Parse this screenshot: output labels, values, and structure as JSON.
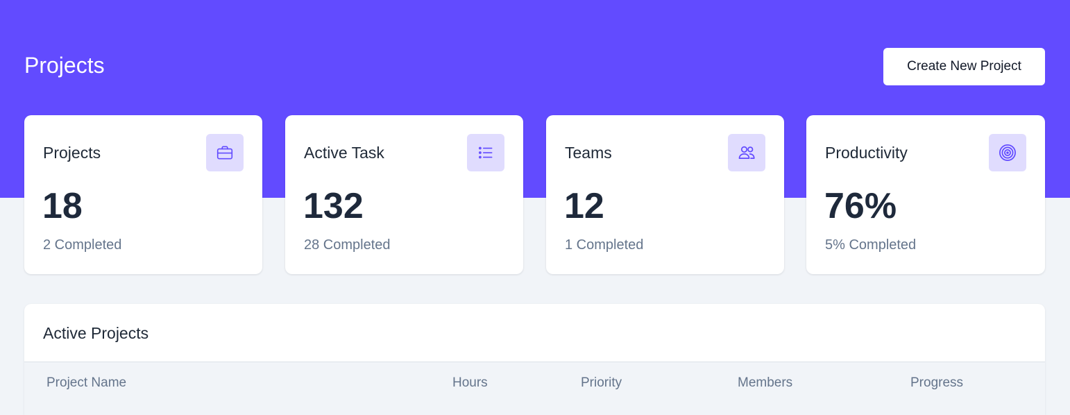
{
  "header": {
    "title": "Projects",
    "create_button_label": "Create New Project"
  },
  "stats": [
    {
      "label": "Projects",
      "value": "18",
      "sub": "2 Completed",
      "icon": "briefcase-icon"
    },
    {
      "label": "Active Task",
      "value": "132",
      "sub": "28 Completed",
      "icon": "list-icon"
    },
    {
      "label": "Teams",
      "value": "12",
      "sub": "1 Completed",
      "icon": "users-icon"
    },
    {
      "label": "Productivity",
      "value": "76%",
      "sub": "5% Completed",
      "icon": "target-icon"
    }
  ],
  "active_projects": {
    "title": "Active Projects",
    "columns": [
      "Project Name",
      "Hours",
      "Priority",
      "Members",
      "Progress"
    ]
  },
  "colors": {
    "brand": "#624bff",
    "icon_bg": "#e0dcfe",
    "page_bg": "#f1f4f8"
  }
}
